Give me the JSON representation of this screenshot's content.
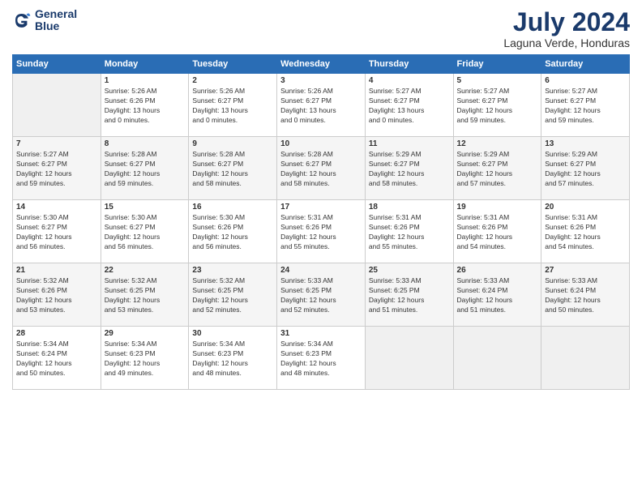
{
  "header": {
    "logo_line1": "General",
    "logo_line2": "Blue",
    "month_title": "July 2024",
    "location": "Laguna Verde, Honduras"
  },
  "days_of_week": [
    "Sunday",
    "Monday",
    "Tuesday",
    "Wednesday",
    "Thursday",
    "Friday",
    "Saturday"
  ],
  "weeks": [
    [
      {
        "day": "",
        "sunrise": "",
        "sunset": "",
        "daylight": ""
      },
      {
        "day": "1",
        "sunrise": "Sunrise: 5:26 AM",
        "sunset": "Sunset: 6:26 PM",
        "daylight": "Daylight: 13 hours and 0 minutes."
      },
      {
        "day": "2",
        "sunrise": "Sunrise: 5:26 AM",
        "sunset": "Sunset: 6:27 PM",
        "daylight": "Daylight: 13 hours and 0 minutes."
      },
      {
        "day": "3",
        "sunrise": "Sunrise: 5:26 AM",
        "sunset": "Sunset: 6:27 PM",
        "daylight": "Daylight: 13 hours and 0 minutes."
      },
      {
        "day": "4",
        "sunrise": "Sunrise: 5:27 AM",
        "sunset": "Sunset: 6:27 PM",
        "daylight": "Daylight: 13 hours and 0 minutes."
      },
      {
        "day": "5",
        "sunrise": "Sunrise: 5:27 AM",
        "sunset": "Sunset: 6:27 PM",
        "daylight": "Daylight: 12 hours and 59 minutes."
      },
      {
        "day": "6",
        "sunrise": "Sunrise: 5:27 AM",
        "sunset": "Sunset: 6:27 PM",
        "daylight": "Daylight: 12 hours and 59 minutes."
      }
    ],
    [
      {
        "day": "7",
        "sunrise": "Sunrise: 5:27 AM",
        "sunset": "Sunset: 6:27 PM",
        "daylight": "Daylight: 12 hours and 59 minutes."
      },
      {
        "day": "8",
        "sunrise": "Sunrise: 5:28 AM",
        "sunset": "Sunset: 6:27 PM",
        "daylight": "Daylight: 12 hours and 59 minutes."
      },
      {
        "day": "9",
        "sunrise": "Sunrise: 5:28 AM",
        "sunset": "Sunset: 6:27 PM",
        "daylight": "Daylight: 12 hours and 58 minutes."
      },
      {
        "day": "10",
        "sunrise": "Sunrise: 5:28 AM",
        "sunset": "Sunset: 6:27 PM",
        "daylight": "Daylight: 12 hours and 58 minutes."
      },
      {
        "day": "11",
        "sunrise": "Sunrise: 5:29 AM",
        "sunset": "Sunset: 6:27 PM",
        "daylight": "Daylight: 12 hours and 58 minutes."
      },
      {
        "day": "12",
        "sunrise": "Sunrise: 5:29 AM",
        "sunset": "Sunset: 6:27 PM",
        "daylight": "Daylight: 12 hours and 57 minutes."
      },
      {
        "day": "13",
        "sunrise": "Sunrise: 5:29 AM",
        "sunset": "Sunset: 6:27 PM",
        "daylight": "Daylight: 12 hours and 57 minutes."
      }
    ],
    [
      {
        "day": "14",
        "sunrise": "Sunrise: 5:30 AM",
        "sunset": "Sunset: 6:27 PM",
        "daylight": "Daylight: 12 hours and 56 minutes."
      },
      {
        "day": "15",
        "sunrise": "Sunrise: 5:30 AM",
        "sunset": "Sunset: 6:27 PM",
        "daylight": "Daylight: 12 hours and 56 minutes."
      },
      {
        "day": "16",
        "sunrise": "Sunrise: 5:30 AM",
        "sunset": "Sunset: 6:26 PM",
        "daylight": "Daylight: 12 hours and 56 minutes."
      },
      {
        "day": "17",
        "sunrise": "Sunrise: 5:31 AM",
        "sunset": "Sunset: 6:26 PM",
        "daylight": "Daylight: 12 hours and 55 minutes."
      },
      {
        "day": "18",
        "sunrise": "Sunrise: 5:31 AM",
        "sunset": "Sunset: 6:26 PM",
        "daylight": "Daylight: 12 hours and 55 minutes."
      },
      {
        "day": "19",
        "sunrise": "Sunrise: 5:31 AM",
        "sunset": "Sunset: 6:26 PM",
        "daylight": "Daylight: 12 hours and 54 minutes."
      },
      {
        "day": "20",
        "sunrise": "Sunrise: 5:31 AM",
        "sunset": "Sunset: 6:26 PM",
        "daylight": "Daylight: 12 hours and 54 minutes."
      }
    ],
    [
      {
        "day": "21",
        "sunrise": "Sunrise: 5:32 AM",
        "sunset": "Sunset: 6:26 PM",
        "daylight": "Daylight: 12 hours and 53 minutes."
      },
      {
        "day": "22",
        "sunrise": "Sunrise: 5:32 AM",
        "sunset": "Sunset: 6:25 PM",
        "daylight": "Daylight: 12 hours and 53 minutes."
      },
      {
        "day": "23",
        "sunrise": "Sunrise: 5:32 AM",
        "sunset": "Sunset: 6:25 PM",
        "daylight": "Daylight: 12 hours and 52 minutes."
      },
      {
        "day": "24",
        "sunrise": "Sunrise: 5:33 AM",
        "sunset": "Sunset: 6:25 PM",
        "daylight": "Daylight: 12 hours and 52 minutes."
      },
      {
        "day": "25",
        "sunrise": "Sunrise: 5:33 AM",
        "sunset": "Sunset: 6:25 PM",
        "daylight": "Daylight: 12 hours and 51 minutes."
      },
      {
        "day": "26",
        "sunrise": "Sunrise: 5:33 AM",
        "sunset": "Sunset: 6:24 PM",
        "daylight": "Daylight: 12 hours and 51 minutes."
      },
      {
        "day": "27",
        "sunrise": "Sunrise: 5:33 AM",
        "sunset": "Sunset: 6:24 PM",
        "daylight": "Daylight: 12 hours and 50 minutes."
      }
    ],
    [
      {
        "day": "28",
        "sunrise": "Sunrise: 5:34 AM",
        "sunset": "Sunset: 6:24 PM",
        "daylight": "Daylight: 12 hours and 50 minutes."
      },
      {
        "day": "29",
        "sunrise": "Sunrise: 5:34 AM",
        "sunset": "Sunset: 6:23 PM",
        "daylight": "Daylight: 12 hours and 49 minutes."
      },
      {
        "day": "30",
        "sunrise": "Sunrise: 5:34 AM",
        "sunset": "Sunset: 6:23 PM",
        "daylight": "Daylight: 12 hours and 48 minutes."
      },
      {
        "day": "31",
        "sunrise": "Sunrise: 5:34 AM",
        "sunset": "Sunset: 6:23 PM",
        "daylight": "Daylight: 12 hours and 48 minutes."
      },
      {
        "day": "",
        "sunrise": "",
        "sunset": "",
        "daylight": ""
      },
      {
        "day": "",
        "sunrise": "",
        "sunset": "",
        "daylight": ""
      },
      {
        "day": "",
        "sunrise": "",
        "sunset": "",
        "daylight": ""
      }
    ]
  ]
}
